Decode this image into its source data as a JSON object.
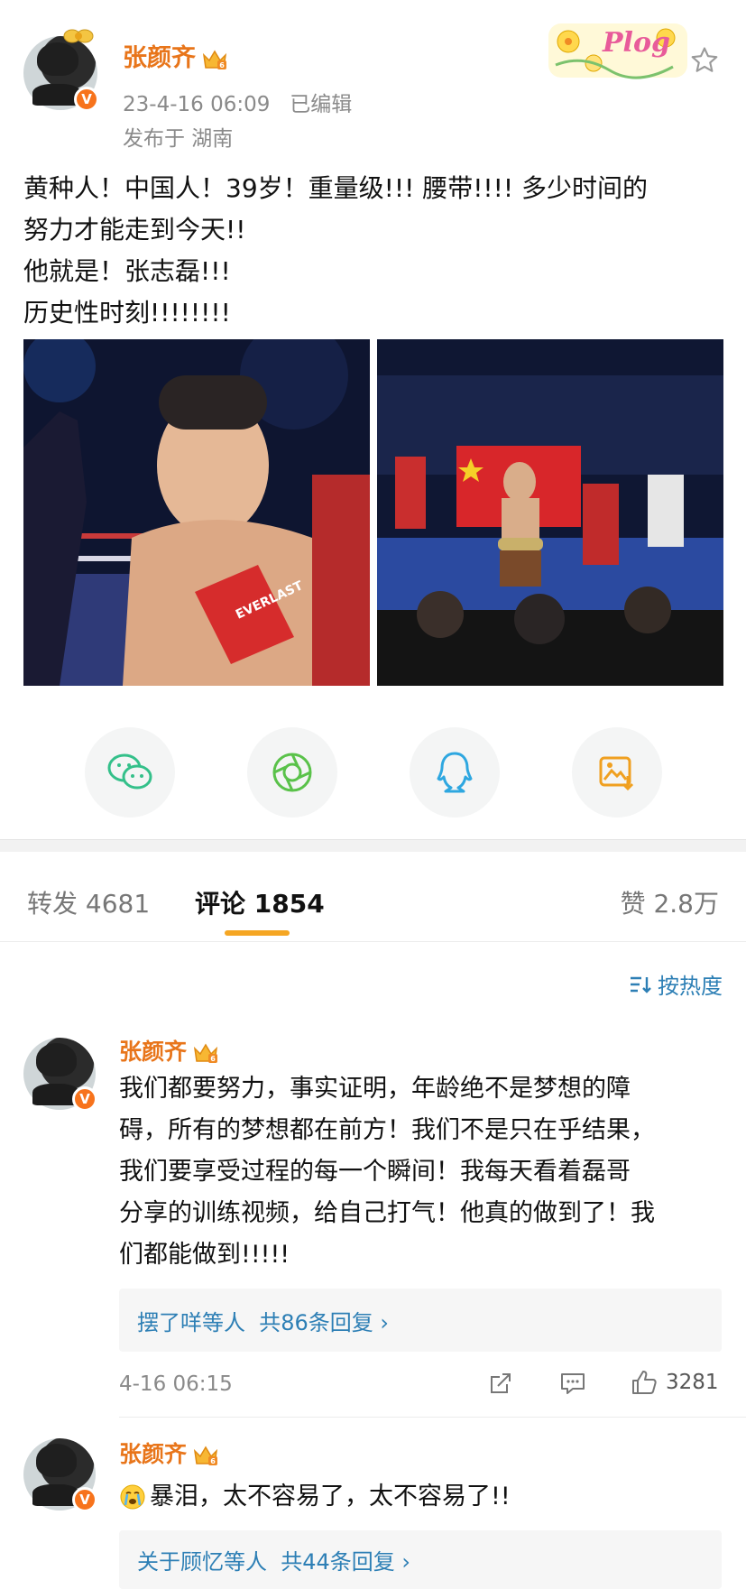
{
  "post": {
    "author": "张颜齐",
    "time": "23-4-16 06:09",
    "edited": "已编辑",
    "location": "发布于 湖南",
    "sticker": "Plog",
    "text_lines": [
      "黄种人！中国人！39岁！重量级!!! 腰带!!!! 多少时间的",
      "努力才能走到今天!!",
      "他就是！张志磊!!!",
      "历史性时刻!!!!!!!!"
    ],
    "glove_text": "EVERLAST",
    "badge_letter": "V",
    "share": [
      "wechat-icon",
      "moments-icon",
      "qq-icon",
      "save-image-icon"
    ]
  },
  "tabs": {
    "repost": "转发 4681",
    "comment": "评论 1854",
    "like": "赞 2.8万"
  },
  "sort": {
    "label": "按热度"
  },
  "comments": [
    {
      "author": "张颜齐",
      "lines": [
        "我们都要努力，事实证明，年龄绝不是梦想的障",
        "碍，所有的梦想都在前方！我们不是只在乎结果，",
        "我们要享受过程的每一个瞬间！我每天看着磊哥",
        "分享的训练视频，给自己打气！他真的做到了！我",
        "们都能做到!!!!!"
      ],
      "reply_people": "摆了咩等人",
      "reply_count": "共86条回复 ›",
      "time": "4-16 06:15",
      "likes": "3281"
    },
    {
      "author": "张颜齐",
      "text": "暴泪，太不容易了，太不容易了!!",
      "reply_people": "关于顾忆等人",
      "reply_count": "共44条回复 ›"
    }
  ],
  "colors": {
    "name": "#e8751a",
    "link": "#2d7fb5",
    "tab_underline": "#f5a623",
    "vip_badge": "#f7731c"
  }
}
